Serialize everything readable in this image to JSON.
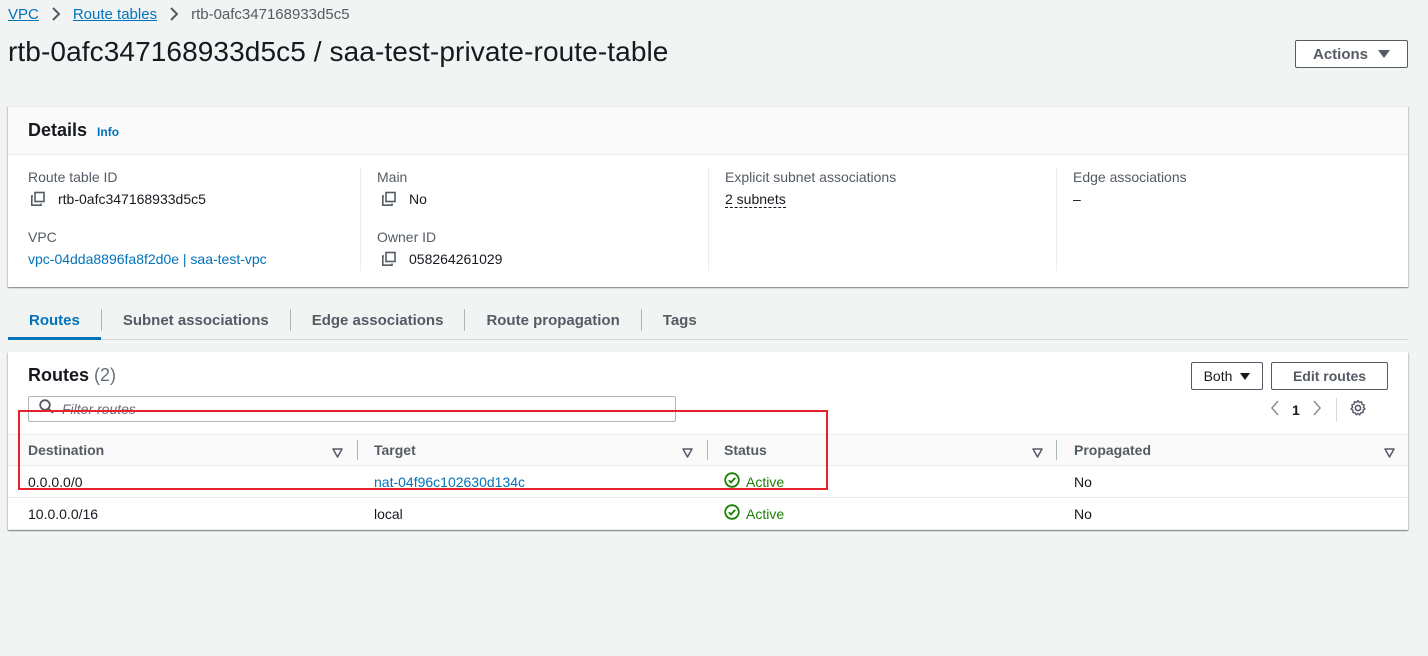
{
  "breadcrumb": {
    "items": [
      "VPC",
      "Route tables"
    ],
    "current": "rtb-0afc347168933d5c5"
  },
  "header": {
    "title": "rtb-0afc347168933d5c5 / saa-test-private-route-table",
    "actions_label": "Actions"
  },
  "details": {
    "title": "Details",
    "info_label": "Info",
    "route_table_id_label": "Route table ID",
    "route_table_id": "rtb-0afc347168933d5c5",
    "main_label": "Main",
    "main_value": "No",
    "explicit_subnet_label": "Explicit subnet associations",
    "explicit_subnet_value": "2 subnets",
    "edge_assoc_label": "Edge associations",
    "edge_assoc_value": "–",
    "vpc_label": "VPC",
    "vpc_value": "vpc-04dda8896fa8f2d0e | saa-test-vpc",
    "owner_id_label": "Owner ID",
    "owner_id_value": "058264261029"
  },
  "tabs": [
    {
      "label": "Routes",
      "active": true
    },
    {
      "label": "Subnet associations",
      "active": false
    },
    {
      "label": "Edge associations",
      "active": false
    },
    {
      "label": "Route propagation",
      "active": false
    },
    {
      "label": "Tags",
      "active": false
    }
  ],
  "routes": {
    "title": "Routes",
    "count": "(2)",
    "both_label": "Both",
    "edit_label": "Edit routes",
    "filter_placeholder": "Filter routes",
    "page": "1",
    "columns": [
      "Destination",
      "Target",
      "Status",
      "Propagated"
    ],
    "rows": [
      {
        "destination": "0.0.0.0/0",
        "target": "nat-04f96c102630d134c",
        "target_is_link": true,
        "status": "Active",
        "propagated": "No"
      },
      {
        "destination": "10.0.0.0/16",
        "target": "local",
        "target_is_link": false,
        "status": "Active",
        "propagated": "No"
      }
    ]
  },
  "colors": {
    "link": "#0073bb",
    "status_active": "#1d8102",
    "highlight": "#e8222b",
    "background": "#f2f3f3"
  }
}
